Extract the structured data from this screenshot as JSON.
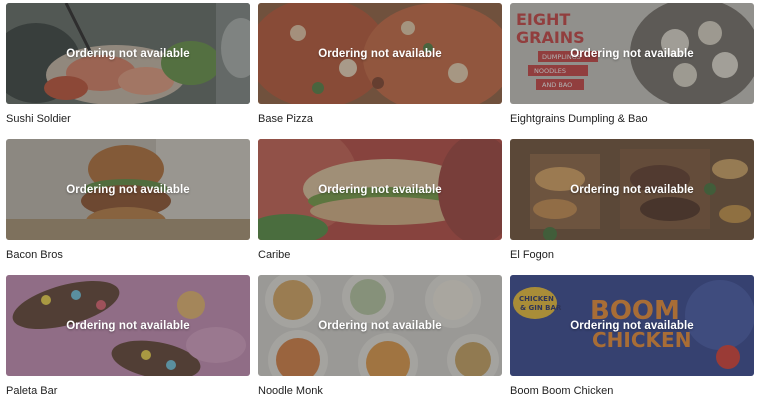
{
  "status_overlay": "Ordering not available",
  "restaurants": [
    {
      "name": "Sushi Soldier"
    },
    {
      "name": "Base Pizza"
    },
    {
      "name": "Eightgrains Dumpling & Bao",
      "image_text": [
        "EIGHT",
        "GRAINS",
        "DUMPLINGS",
        "NOODLES",
        "AND BAO"
      ]
    },
    {
      "name": "Bacon Bros"
    },
    {
      "name": "Caribe"
    },
    {
      "name": "El Fogon"
    },
    {
      "name": "Paleta Bar"
    },
    {
      "name": "Noodle Monk"
    },
    {
      "name": "Boom Boom Chicken",
      "image_text": [
        "CHICKEN",
        "& GIN BAR",
        "BOOM",
        "CHICKEN"
      ]
    }
  ]
}
